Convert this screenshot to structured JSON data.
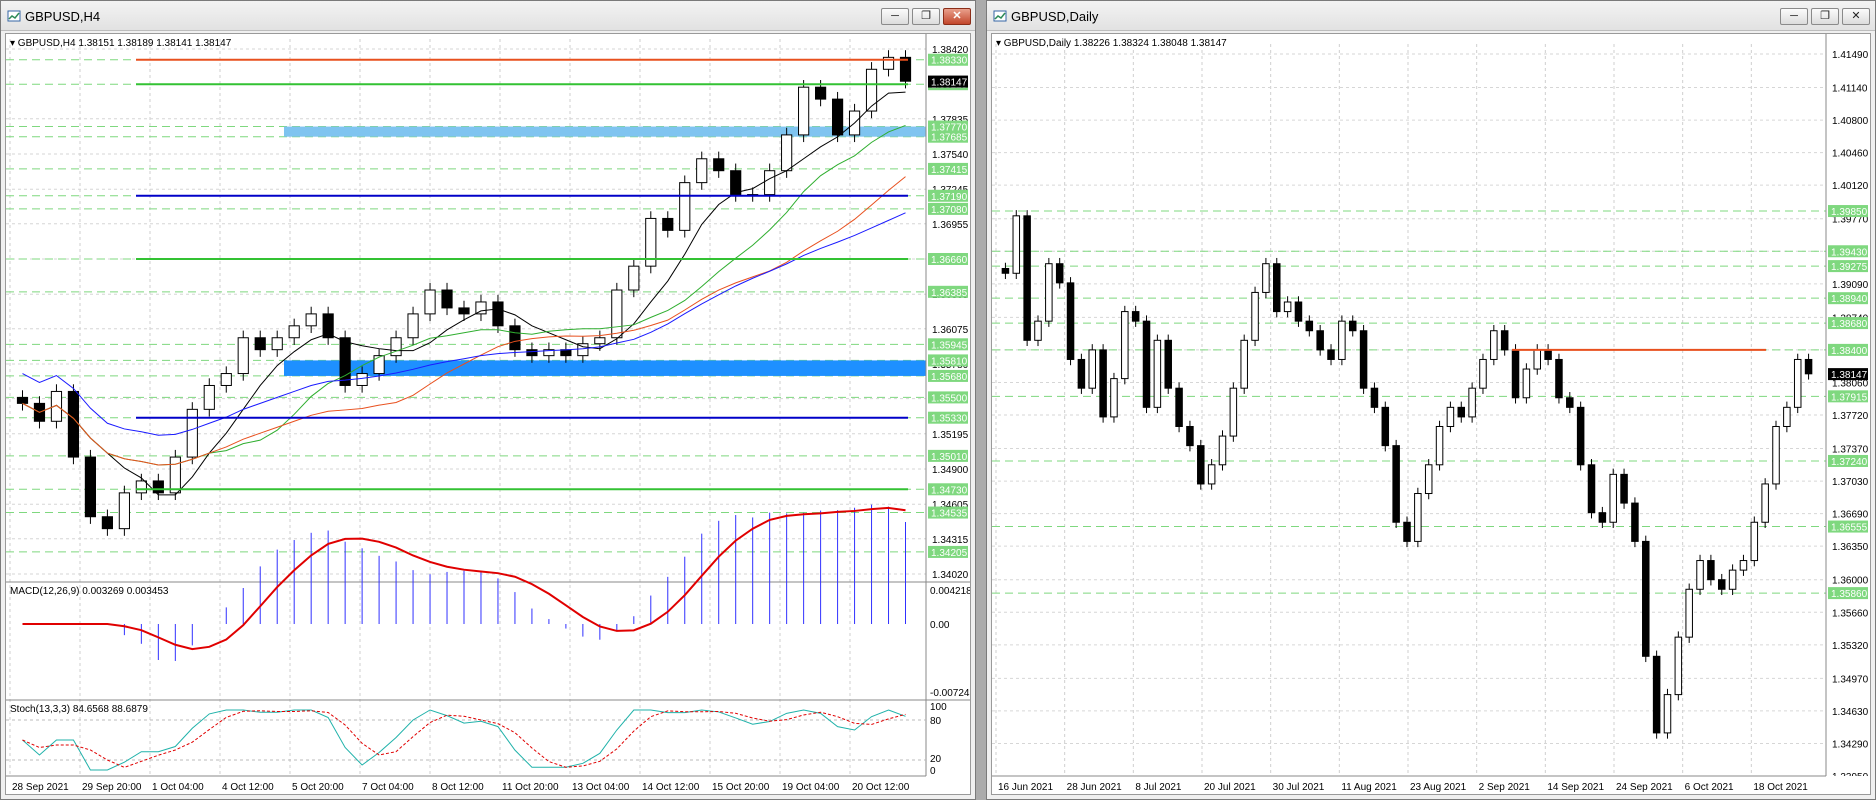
{
  "windows": {
    "h4": {
      "title": "GBPUSD,H4",
      "buttons": [
        "minimize",
        "restore",
        "close"
      ]
    },
    "daily": {
      "title": "GBPUSD,Daily",
      "buttons": [
        "minimize",
        "restore",
        "close"
      ]
    }
  },
  "chart_data": [
    {
      "type": "candlestick",
      "symbol": "GBPUSD",
      "timeframe": "H4",
      "info_line": "GBPUSD,H4  1.38151 1.38189 1.38141 1.38147",
      "y_ticks": [
        "1.38420",
        "1.37835",
        "1.37540",
        "1.37245",
        "1.36955",
        "1.36660",
        "1.36365",
        "1.36075",
        "1.35780",
        "1.35490",
        "1.35195",
        "1.34900",
        "1.34605",
        "1.34315",
        "1.34020"
      ],
      "level_labels": [
        "1.38330",
        "1.38125",
        "1.37770",
        "1.37685",
        "1.37415",
        "1.37190",
        "1.37080",
        "1.36660",
        "1.36385",
        "1.35945",
        "1.35810",
        "1.35680",
        "1.35500",
        "1.35330",
        "1.35010",
        "1.34730",
        "1.34535",
        "1.34205"
      ],
      "x_labels": [
        "28 Sep 2021",
        "29 Sep 20:00",
        "1 Oct 04:00",
        "4 Oct 12:00",
        "5 Oct 20:00",
        "7 Oct 04:00",
        "8 Oct 12:00",
        "11 Oct 20:00",
        "13 Oct 04:00",
        "14 Oct 12:00",
        "15 Oct 20:00",
        "19 Oct 04:00",
        "20 Oct 12:00"
      ],
      "ylim": [
        1.3402,
        1.3842
      ],
      "horizontal_lines": [
        {
          "price": 1.3833,
          "color": "#e8501e"
        },
        {
          "price": 1.38125,
          "color": "#33c233"
        },
        {
          "price": 1.3719,
          "color": "#0000c8"
        },
        {
          "price": 1.3666,
          "color": "#33c233"
        },
        {
          "price": 1.3533,
          "color": "#0000c8"
        },
        {
          "price": 1.3473,
          "color": "#33c233"
        }
      ],
      "zones": [
        {
          "from": 1.37685,
          "to": 1.3777,
          "color": "#7fc4f0"
        },
        {
          "from": 1.3568,
          "to": 1.3581,
          "color": "#1e90ff"
        }
      ],
      "close_series": [
        1.3545,
        1.353,
        1.3555,
        1.35,
        1.345,
        1.344,
        1.347,
        1.348,
        1.347,
        1.35,
        1.354,
        1.356,
        1.357,
        1.36,
        1.359,
        1.36,
        1.361,
        1.362,
        1.36,
        1.356,
        1.357,
        1.3585,
        1.36,
        1.362,
        1.364,
        1.3625,
        1.362,
        1.363,
        1.361,
        1.359,
        1.3585,
        1.359,
        1.3585,
        1.3595,
        1.36,
        1.364,
        1.366,
        1.37,
        1.369,
        1.373,
        1.375,
        1.374,
        1.372,
        1.372,
        1.374,
        1.377,
        1.381,
        1.38,
        1.377,
        1.379,
        1.3825,
        1.3835,
        1.3815
      ],
      "ma_lines": [
        {
          "color": "#000000",
          "label": "fast MA"
        },
        {
          "color": "#2fae2f",
          "label": "MA"
        },
        {
          "color": "#e8501e",
          "label": "MA"
        },
        {
          "color": "#1a1aff",
          "label": "MA"
        }
      ],
      "macd": {
        "label": "MACD(12,26,9) 0.003269 0.003453",
        "y_ticks": [
          "0.004218",
          "0.00",
          "-0.007248"
        ]
      },
      "stoch": {
        "label": "Stoch(13,3,3) 84.6568 88.6879",
        "y_ticks": [
          "100",
          "80",
          "20",
          "0"
        ]
      },
      "last_price": "1.38147"
    },
    {
      "type": "candlestick",
      "symbol": "GBPUSD",
      "timeframe": "Daily",
      "info_line": "GBPUSD,Daily  1.38226 1.38324 1.38048 1.38147",
      "y_ticks": [
        "1.41490",
        "1.41140",
        "1.40800",
        "1.40460",
        "1.40120",
        "1.39770",
        "1.39430",
        "1.39090",
        "1.38740",
        "1.38400",
        "1.38060",
        "1.37720",
        "1.37370",
        "1.37030",
        "1.36690",
        "1.36350",
        "1.36000",
        "1.35660",
        "1.35320",
        "1.34970",
        "1.34630",
        "1.34290",
        "1.33950"
      ],
      "level_labels": [
        "1.39850",
        "1.39430",
        "1.39275",
        "1.38940",
        "1.38680",
        "1.38400",
        "1.37915",
        "1.37240",
        "1.36555",
        "1.35860"
      ],
      "x_labels": [
        "16 Jun 2021",
        "28 Jun 2021",
        "8 Jul 2021",
        "20 Jul 2021",
        "30 Jul 2021",
        "11 Aug 2021",
        "23 Aug 2021",
        "2 Sep 2021",
        "14 Sep 2021",
        "24 Sep 2021",
        "6 Oct 2021",
        "18 Oct 2021"
      ],
      "ylim": [
        1.3395,
        1.4149
      ],
      "horizontal_lines": [
        {
          "price": 1.384,
          "color": "#e8501e"
        }
      ],
      "close_series": [
        1.392,
        1.398,
        1.385,
        1.387,
        1.393,
        1.391,
        1.383,
        1.38,
        1.384,
        1.377,
        1.381,
        1.388,
        1.387,
        1.378,
        1.385,
        1.38,
        1.376,
        1.374,
        1.37,
        1.372,
        1.375,
        1.38,
        1.385,
        1.39,
        1.393,
        1.388,
        1.389,
        1.387,
        1.386,
        1.384,
        1.383,
        1.387,
        1.386,
        1.38,
        1.378,
        1.374,
        1.366,
        1.364,
        1.369,
        1.372,
        1.376,
        1.378,
        1.377,
        1.38,
        1.383,
        1.386,
        1.384,
        1.379,
        1.382,
        1.384,
        1.383,
        1.379,
        1.378,
        1.372,
        1.367,
        1.366,
        1.371,
        1.368,
        1.364,
        1.352,
        1.344,
        1.348,
        1.354,
        1.359,
        1.362,
        1.36,
        1.359,
        1.361,
        1.362,
        1.366,
        1.37,
        1.376,
        1.378,
        1.383,
        1.3815
      ],
      "last_price": "1.38147"
    }
  ]
}
